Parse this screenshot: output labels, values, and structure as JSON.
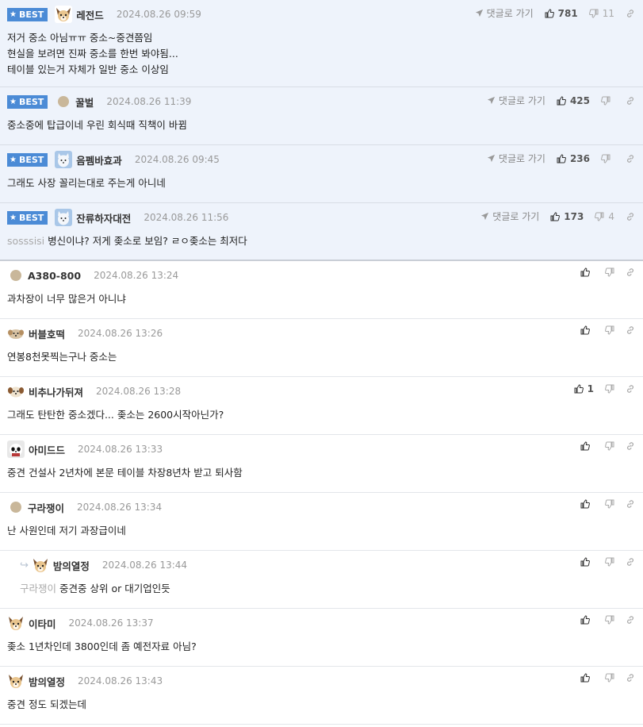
{
  "best_label": "BEST",
  "reply_label": "댓글로 가기",
  "best_comments": [
    {
      "nick": "레전드",
      "date": "2024.08.26 09:59",
      "lines": [
        "저거 중소 아님ㅠㅠ 중소~중견쯤임",
        "현실을 보려면 진짜 중소를 한번 봐야됨...",
        "테이블 있는거 자체가 일반 중소 이상임"
      ],
      "up": "781",
      "down": "11",
      "avatar": "dog-icon"
    },
    {
      "nick": "꿀벌",
      "date": "2024.08.26 11:39",
      "lines": [
        "중소중에 탑급이네 우린 회식때 직책이 바뀜"
      ],
      "up": "425",
      "down": "",
      "avatar": "dot-icon"
    },
    {
      "nick": "음펨바효과",
      "date": "2024.08.26 09:45",
      "lines": [
        "그래도 사장 꼴리는대로 주는게 아니네"
      ],
      "up": "236",
      "down": "",
      "avatar": "fox-icon"
    },
    {
      "nick": "잔류하자대전",
      "date": "2024.08.26 11:56",
      "mention": "sosssisi",
      "lines": [
        "병신이냐? 저게 좆소로 보임? ㄹㅇ좆소는 최저다"
      ],
      "up": "173",
      "down": "4",
      "avatar": "fox-icon"
    }
  ],
  "comments": [
    {
      "nick": "A380-800",
      "date": "2024.08.26 13:24",
      "text": "과차장이 너무 많은거 아니냐",
      "up": "",
      "avatar": "dot-icon"
    },
    {
      "nick": "버블호떡",
      "date": "2024.08.26 13:26",
      "text": "연봉8천못찍는구나 중소는",
      "up": "",
      "avatar": "puppy-icon"
    },
    {
      "nick": "비추나가뒤져",
      "date": "2024.08.26 13:28",
      "text": "그래도 탄탄한 중소겠다... 좆소는 2600시작아닌가?",
      "up": "1",
      "avatar": "puppy-icon"
    },
    {
      "nick": "아미드드",
      "date": "2024.08.26 13:33",
      "text": "중견 건설사 2년차에 본문 테이블 차장8년차 받고 퇴사함",
      "up": "",
      "avatar": "panda-icon"
    },
    {
      "nick": "구라쟁이",
      "date": "2024.08.26 13:34",
      "text": "난 사원인데 저기 과장급이네",
      "up": "",
      "avatar": "dot-icon"
    },
    {
      "nick": "밤의열정",
      "date": "2024.08.26 13:44",
      "mention": "구라쟁이",
      "text": "중견중 상위 or 대기업인듯",
      "up": "",
      "avatar": "dog-icon",
      "is_reply": true
    },
    {
      "nick": "이타미",
      "date": "2024.08.26 13:37",
      "text": "좆소 1년차인데 3800인데 좀 예전자료 아님?",
      "up": "",
      "avatar": "dog-icon"
    },
    {
      "nick": "밤의열정",
      "date": "2024.08.26 13:43",
      "text": "중견 정도 되겠는데",
      "up": "",
      "avatar": "dog-icon"
    }
  ]
}
